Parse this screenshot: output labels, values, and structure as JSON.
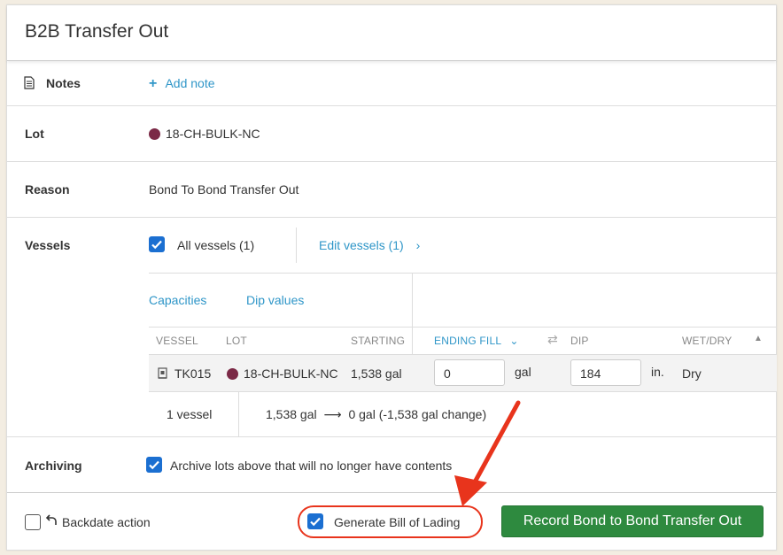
{
  "title": "B2B Transfer Out",
  "notes": {
    "label": "Notes",
    "add_label": "Add note"
  },
  "lot": {
    "label": "Lot",
    "value": "18-CH-BULK-NC",
    "dot_color": "#7b2946"
  },
  "reason": {
    "label": "Reason",
    "value": "Bond To Bond Transfer Out"
  },
  "vessels": {
    "label": "Vessels",
    "all_label": "All vessels (1)",
    "edit_label": "Edit vessels (1)",
    "tab_capacities": "Capacities",
    "tab_dip": "Dip values",
    "columns": {
      "vessel": "VESSEL",
      "lot": "LOT",
      "starting": "STARTING",
      "ending_fill": "ENDING FILL",
      "dip": "DIP",
      "wet_dry": "WET/DRY"
    },
    "rows": [
      {
        "vessel": "TK015",
        "lot": "18-CH-BULK-NC",
        "starting": "1,538 gal",
        "ending_value": "0",
        "ending_unit": "gal",
        "dip_value": "184",
        "dip_unit": "in.",
        "wet_dry": "Dry"
      }
    ],
    "summary_count": "1 vessel",
    "summary_from": "1,538 gal",
    "summary_to": "0 gal (-1,538 gal change)"
  },
  "archiving": {
    "label": "Archiving",
    "text": "Archive lots above that will no longer have contents"
  },
  "footer": {
    "backdate_label": "Backdate action",
    "bol_label": "Generate Bill of Lading",
    "record_label": "Record Bond to Bond Transfer Out"
  },
  "colors": {
    "accent": "#2f96c8",
    "checkbox": "#1b6fd1",
    "primary_button": "#2e8a3f",
    "annotation": "#e8341c"
  }
}
